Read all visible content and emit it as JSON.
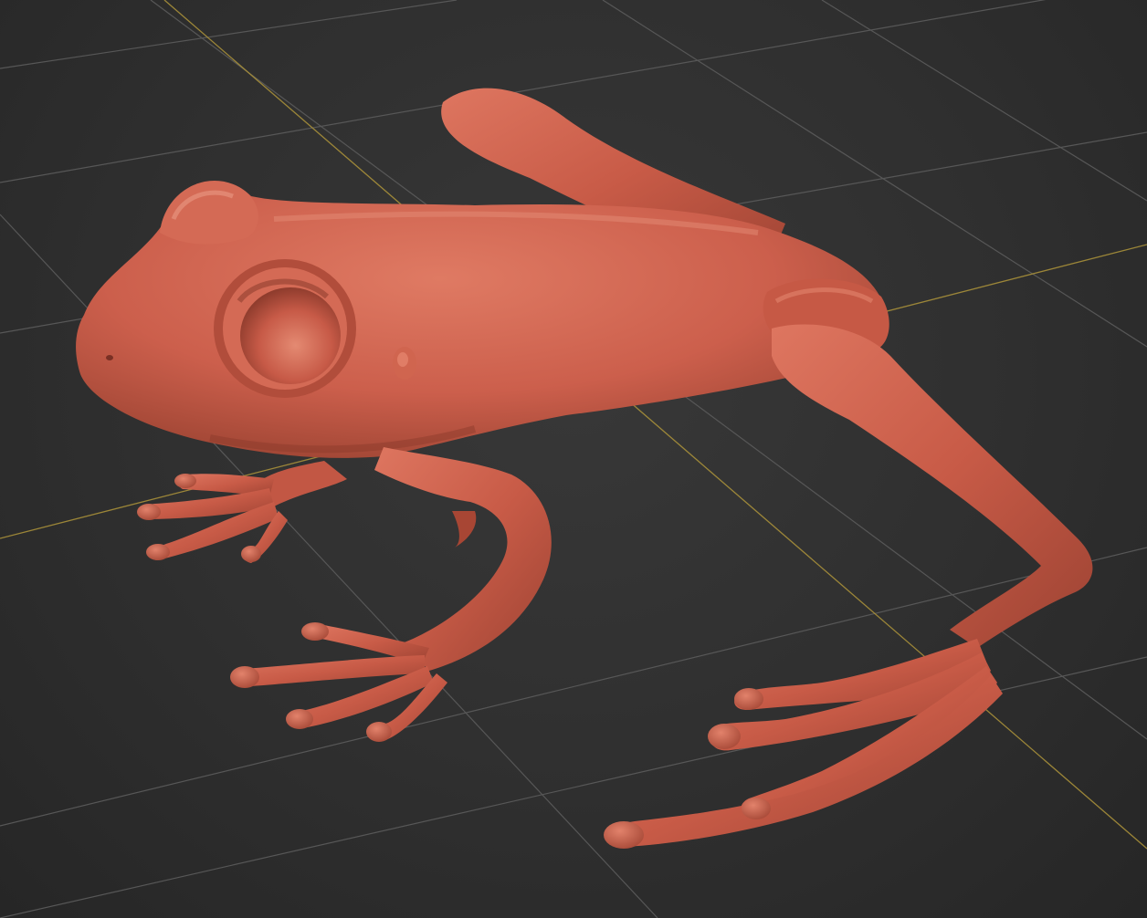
{
  "viewport": {
    "label": "",
    "background_color": "#2f2f2f",
    "grid_color": "#555555",
    "axis_color": "#b39a3a"
  },
  "model": {
    "name": "",
    "object": "frog sculpt",
    "surface_color": "#cc5f4c",
    "highlight_color": "#e08a74",
    "shadow_color": "#7e3328"
  }
}
